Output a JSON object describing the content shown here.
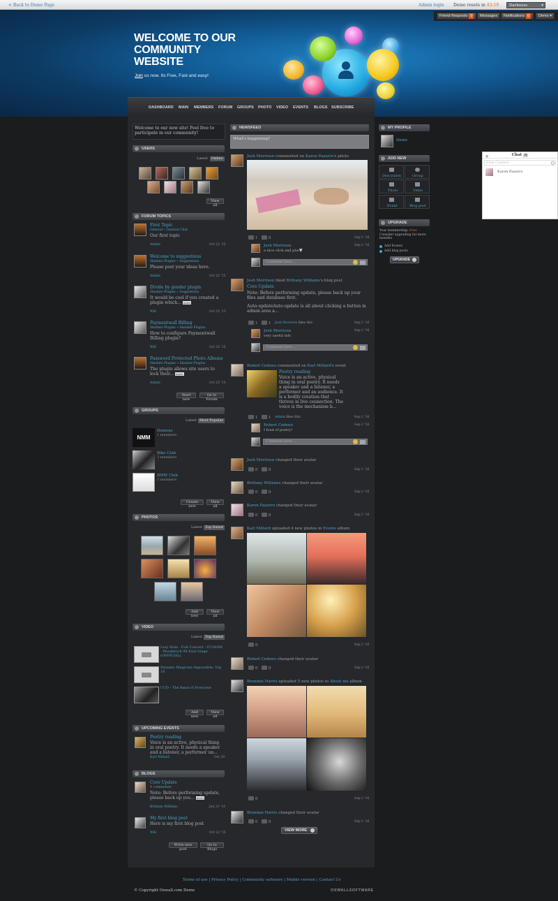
{
  "topbar": {
    "back_link": "< Back to Demo Page",
    "admin_login": "Admin login",
    "demo_resets_label": "Demo resets in",
    "demo_resets_time": "43:19",
    "theme_selected": "Darkness"
  },
  "usermenu": {
    "friend_requests": "Friend Requests",
    "friend_requests_count": "0",
    "messages": "Messages",
    "notifications": "Notifications",
    "notifications_count": "0",
    "user": "Demo"
  },
  "header": {
    "line1": "WELCOME TO OUR",
    "line2": "COMMUNITY",
    "line3": "WEBSITE",
    "join": "Join",
    "tagline": " us now. Its Free, Fast and easy!"
  },
  "nav": [
    "DASHBOARD",
    "MAIN",
    "MEMBERS",
    "FORUM",
    "GROUPS",
    "PHOTO",
    "VIDEO",
    "EVENTS",
    "BLOGS",
    "SUBSCRIBE"
  ],
  "welcome_text": "Welcome to our new site! Feel free to participate in our community!",
  "users": {
    "title": "USERS",
    "tab_latest": "Latest",
    "tab_online": "Online",
    "view_all": "View all"
  },
  "forum": {
    "title": "FORUM TOPICS",
    "topics": [
      {
        "title": "First Topic",
        "path": "General » General Chat",
        "text": "Our first topic",
        "user": "Admin",
        "date": "Oct 22 '15"
      },
      {
        "title": "Welcome to suggestions",
        "path": "Skadate Plugins » Suggestions",
        "text": "Please post your ideas here.",
        "user": "Admin",
        "date": "Oct 22 '15"
      },
      {
        "title": "Divide by gender plugin",
        "path": "Skadate Plugins » Suggestions",
        "text": "It would be cool if you created a plugin which...",
        "more": "more",
        "user": "Will",
        "date": "Oct 23 '15"
      },
      {
        "title": "Paymentwall Billing",
        "path": "Skadate Plugins » Skadate Plugins",
        "text": "How to configure Paymentwall Billing plugin?",
        "user": "Will",
        "date": "Oct 23 '15"
      },
      {
        "title": "Password Protected Photo Albums",
        "path": "Skadate Plugins » Skadate Plugins",
        "text": "The plugin allows site users to lock their...",
        "more": "more",
        "user": "Admin",
        "date": "Oct 23 '15"
      }
    ],
    "start_new": "Start new",
    "go_forum": "Go to Forum"
  },
  "groups": {
    "title": "GROUPS",
    "tab_latest": "Latest",
    "tab_popular": "Most Popular",
    "items": [
      {
        "name": "Demons",
        "count": "1",
        "label": "members"
      },
      {
        "name": "Bike Club",
        "count": "3",
        "label": "members"
      },
      {
        "name": "BMW Club",
        "count": "3",
        "label": "members"
      }
    ],
    "create_new": "Create new",
    "view_all": "View all"
  },
  "photos": {
    "title": "PHOTOS",
    "tab_latest": "Latest",
    "tab_top": "Top Rated",
    "add_new": "Add new",
    "view_all": "View all"
  },
  "video": {
    "title": "VIDEO",
    "tab_latest": "Latest",
    "tab_top": "Top Rated",
    "items": [
      "Lzzy Hale - Full Concert - 07/26/06 - Woodstock 99 East Stage (OFFICIAL)",
      "Dynamo Magician Impossible: Top 10",
      "CUD - The Band of Everyone"
    ],
    "add_new": "Add new",
    "view_all": "View all"
  },
  "events": {
    "title": "UPCOMING EVENTS",
    "event_title": "Poetry reading",
    "event_text": "Voice is an active, physical thing in oral poetry. It needs a speaker and a listener, a performer un...",
    "user": "Karl Millard",
    "date": "Oct 29"
  },
  "blogs": {
    "title": "BLOGS",
    "items": [
      {
        "title": "Core Update",
        "count": "4",
        "comments": "comments",
        "text": "Note: Before performing update, please back up you...",
        "more": "more",
        "user": "Brittany Williams",
        "date": "Jun 21 '16"
      },
      {
        "title": "My first blog post",
        "text": "Here is my first blog post",
        "user": "Will",
        "date": "Oct 23 '15"
      }
    ],
    "write_new": "Write new post",
    "go_blogs": "Go to Blogs"
  },
  "newsfeed": {
    "title": "NEWSFEED",
    "status_placeholder": "What's happening?",
    "comment_placeholder": "Comment here...",
    "view_more": "VIEW MORE",
    "posts": [
      {
        "user": "Josh Morrison",
        "action": "commented on",
        "target": "Karen Pazarro",
        "target_suffix": "'s photo",
        "date": "Sep 2 '16",
        "likes": "1",
        "comments": "0",
        "c_user": "Josh Morrison",
        "c_text": "a nice click and place",
        "c_date": "Sep 2 '16"
      },
      {
        "user": "Josh Morrison",
        "action": "liked",
        "target": "Brittany Williams",
        "target_suffix": "'s blog post",
        "title": "Core Update",
        "text1": "Note: Before performing update, please back up your files and database first.",
        "text2": "Auto-updateAuto-update is all about clicking a button in admin area a...",
        "likes": "1",
        "comments": "1",
        "like_user": "Josh Morrison",
        "like_label": "likes this",
        "date": "Sep 2 '16",
        "c_user": "Josh Morrison",
        "c_text": "very useful info",
        "c_date": "Sep 2 '16"
      },
      {
        "user": "Robert Cedeno",
        "action": "commented on",
        "target": "Karl Millard",
        "target_suffix": "'s event",
        "title": "Poetry reading",
        "text": "Voice is an active, physical thing in oral poetry. It needs a speaker and a listener, a performer and an audience. It is a bodily creation that thrives in live connection. The voice is the mechanism b...",
        "likes": "1",
        "comments": "1",
        "like_user": "Admin",
        "like_label": "likes this",
        "date": "Sep 2 '16",
        "c_user": "Robert Cedeno",
        "c_text": "I fond of poetry!",
        "c_date": "Sep 2 '16"
      },
      {
        "user": "Josh Morrison",
        "action": "changed their avatar",
        "likes": "0",
        "comments": "0",
        "date": "Sep 2 '16"
      },
      {
        "user": "Brittany Williams",
        "action": "changed their avatar",
        "likes": "0",
        "comments": "0",
        "date": "Sep 2 '16"
      },
      {
        "user": "Karen Pazarro",
        "action": "changed their avatar",
        "likes": "0",
        "comments": "0",
        "date": "Sep 2 '16"
      },
      {
        "user": "Karl Millard",
        "action": "uploaded 4 new photos in",
        "target": "Events",
        "target_suffix": " album",
        "comments": "0",
        "date": "Sep 2 '16"
      },
      {
        "user": "Robert Cedeno",
        "action": "changed their avatar",
        "likes": "0",
        "comments": "0",
        "date": "Sep 2 '16"
      },
      {
        "user": "Brendan Harris",
        "action": "uploaded 5 new photos to",
        "target": "About me",
        "target_suffix": " album",
        "comments": "0",
        "date": "Sep 2 '16"
      },
      {
        "user": "Brendan Harris",
        "action": "changed their avatar",
        "likes": "0",
        "comments": "0",
        "date": "Sep 2 '16"
      }
    ]
  },
  "right": {
    "my_profile": "MY PROFILE",
    "profile_name": "Demo",
    "add_new": "ADD NEW",
    "add_items": [
      "Discussion",
      "Group",
      "Photo",
      "Video",
      "Event",
      "Blog post"
    ],
    "upgrade": "UPGRADE",
    "upgrade_text1": "Your membership:",
    "upgrade_free": "Free",
    "upgrade_text2": "Consider upgrading for more benefits",
    "perk1": "Add Events",
    "perk2": "Add blog posts",
    "upgrade_btn": "UPGRADE"
  },
  "chat": {
    "title": "Chat",
    "count": "0",
    "find": "Find Contact",
    "contact": "Karen Pazarro"
  },
  "footer": {
    "links": "Terms of use | Privacy Policy | Community software | Mobile version | Contact Us",
    "copyright": "© Copyright Oxwall.com Demo",
    "brand": "OXWALLSOFTWARE"
  }
}
